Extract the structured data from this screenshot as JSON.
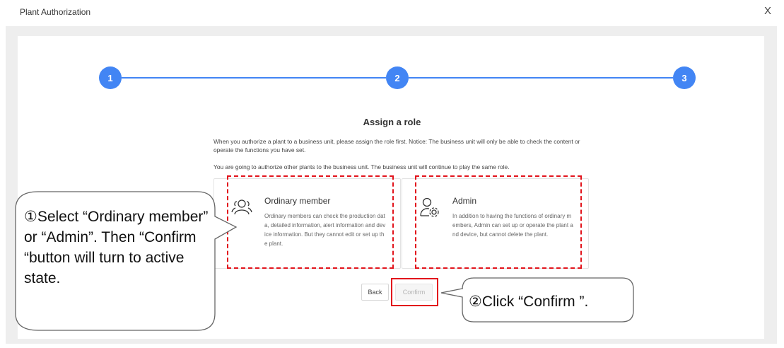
{
  "dialog": {
    "title": "Plant Authorization",
    "close_label": "X"
  },
  "stepper": {
    "steps": [
      "1",
      "2",
      "3"
    ],
    "active_color": "#4285f4"
  },
  "content": {
    "heading": "Assign a role",
    "notice": "When you authorize a plant to a business unit, please assign the role first. Notice: The business unit will only be able to check the content or operate the functions you have set.",
    "info": "You are going to authorize other plants to the business unit. The business unit will continue to play the same role."
  },
  "roles": [
    {
      "title": "Ordinary member",
      "description": "Ordinary members can check the production data, detailed information, alert information and device information. But they cannot edit or set up the plant.",
      "icon": "users-icon"
    },
    {
      "title": "Admin",
      "description": "In addition to having the functions of ordinary members, Admin can set up or operate the plant and device, but cannot delete the plant.",
      "icon": "user-gear-icon"
    }
  ],
  "buttons": {
    "back": "Back",
    "confirm": "Confirm"
  },
  "annotations": {
    "callout1": "①Select “Ordinary member” or “Admin”. Then “Confirm “button will turn to active state.",
    "callout2": "②Click “Confirm ”.",
    "highlight_color": "#e2141c"
  }
}
